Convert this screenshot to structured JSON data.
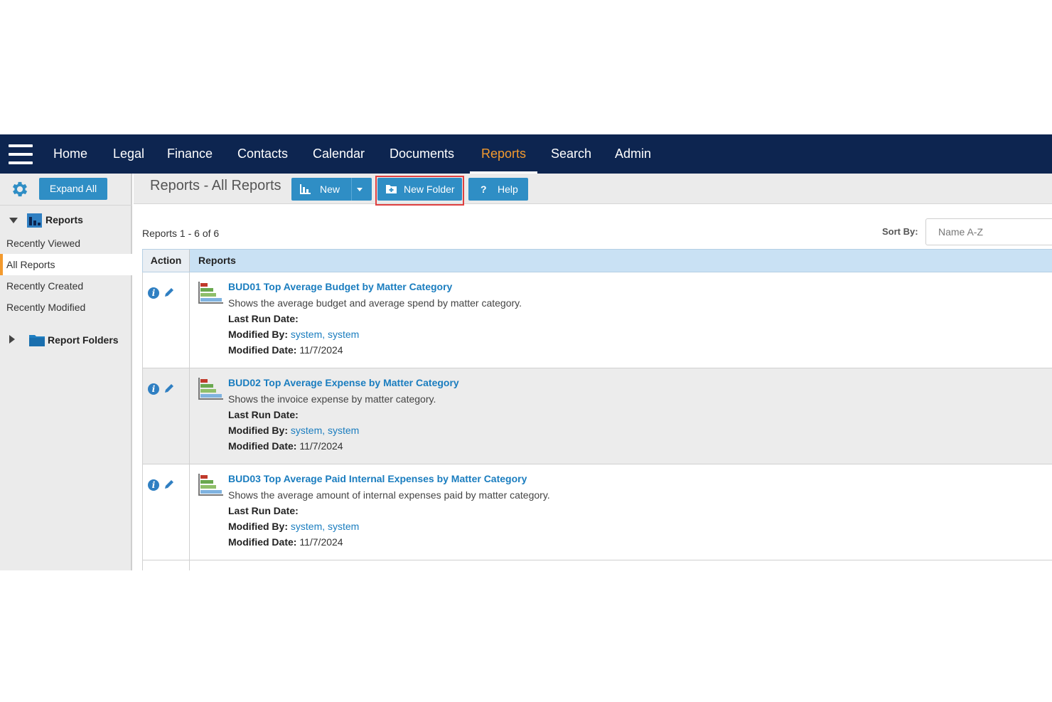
{
  "nav": {
    "items": [
      {
        "label": "Home"
      },
      {
        "label": "Legal"
      },
      {
        "label": "Finance"
      },
      {
        "label": "Contacts"
      },
      {
        "label": "Calendar"
      },
      {
        "label": "Documents"
      },
      {
        "label": "Reports",
        "active": true
      },
      {
        "label": "Search"
      },
      {
        "label": "Admin"
      }
    ]
  },
  "sidebar": {
    "expand_all": "Expand All",
    "tree": {
      "reports_label": "Reports",
      "items": [
        {
          "label": "Recently Viewed"
        },
        {
          "label": "All Reports",
          "selected": true
        },
        {
          "label": "Recently Created"
        },
        {
          "label": "Recently Modified"
        }
      ],
      "folders_label": "Report Folders"
    }
  },
  "toolbar": {
    "title": "Reports - All Reports",
    "new_label": "New",
    "new_folder_label": "New Folder",
    "help_label": "Help"
  },
  "list": {
    "count_text": "Reports 1 - 6 of 6",
    "sort_label": "Sort By:",
    "sort_value": "Name A-Z",
    "columns": {
      "action": "Action",
      "reports": "Reports"
    },
    "field_labels": {
      "last_run": "Last Run Date:",
      "modified_by": "Modified By:",
      "modified_date": "Modified Date:"
    },
    "rows": [
      {
        "title": "BUD01 Top Average Budget by Matter Category",
        "description": "Shows the average budget and average spend by matter category.",
        "last_run": "",
        "modified_by": "system, system",
        "modified_date": "11/7/2024"
      },
      {
        "title": "BUD02 Top Average Expense by Matter Category",
        "description": "Shows the invoice expense by matter category.",
        "last_run": "",
        "modified_by": "system, system",
        "modified_date": "11/7/2024"
      },
      {
        "title": "BUD03 Top Average Paid Internal Expenses by Matter Category",
        "description": "Shows the average amount of internal expenses paid by matter category.",
        "last_run": "",
        "modified_by": "system, system",
        "modified_date": "11/7/2024"
      }
    ]
  },
  "colors": {
    "nav_bg": "#0d2550",
    "accent": "#f39a2e",
    "button": "#2f8ec5",
    "link": "#1a7dbf",
    "highlight": "#e04040"
  }
}
